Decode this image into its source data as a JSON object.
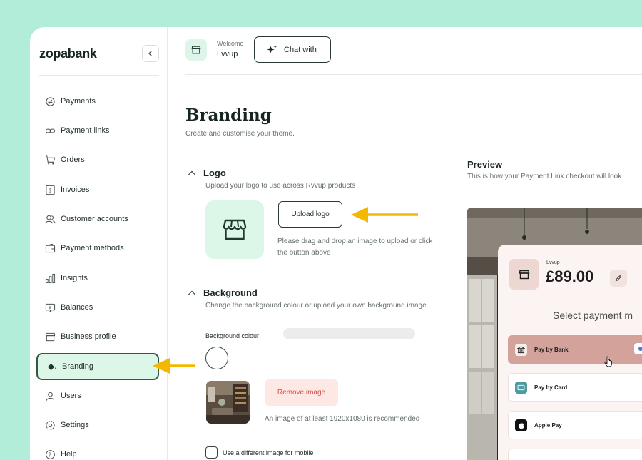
{
  "brand": {
    "name": "zopabank"
  },
  "sidebar": {
    "items": [
      {
        "label": "Payments",
        "icon": "payments-icon"
      },
      {
        "label": "Payment links",
        "icon": "link-icon"
      },
      {
        "label": "Orders",
        "icon": "cart-icon"
      },
      {
        "label": "Invoices",
        "icon": "invoice-icon"
      },
      {
        "label": "Customer accounts",
        "icon": "users-icon"
      },
      {
        "label": "Payment methods",
        "icon": "wallet-icon"
      },
      {
        "label": "Insights",
        "icon": "bar-chart-icon"
      },
      {
        "label": "Balances",
        "icon": "balance-icon"
      },
      {
        "label": "Business profile",
        "icon": "store-icon"
      },
      {
        "label": "Branding",
        "icon": "paint-bucket-icon",
        "active": true
      },
      {
        "label": "Users",
        "icon": "user-icon"
      },
      {
        "label": "Settings",
        "icon": "gear-icon"
      },
      {
        "label": "Help",
        "icon": "help-icon"
      }
    ]
  },
  "header": {
    "welcome_label": "Welcome",
    "account_name": "Lvvup",
    "chat_label": "Chat with"
  },
  "page": {
    "title": "Branding",
    "subtitle": "Create and customise your theme."
  },
  "logo_section": {
    "title": "Logo",
    "description": "Upload your logo to use across Rvvup products",
    "upload_label": "Upload logo",
    "drag_hint": "Please drag and drop an image to upload or click the button above"
  },
  "background_section": {
    "title": "Background",
    "description": "Change the background colour or upload your own background image",
    "colour_label": "Background colour",
    "remove_label": "Remove image",
    "image_hint": "An image of at least 1920x1080 is recommended",
    "mobile_label": "Use a different image for mobile"
  },
  "preview": {
    "title": "Preview",
    "subtitle": "This is how your Payment Link checkout will look",
    "merchant_name": "Lvvup",
    "amount": "£89.00",
    "select_heading": "Select payment m",
    "methods": [
      {
        "label": "Pay by Bank",
        "selected": true
      },
      {
        "label": "Pay by Card",
        "selected": false
      },
      {
        "label": "Apple Pay",
        "selected": false
      }
    ]
  },
  "colors": {
    "background": "#b2edda",
    "accent_green": "#dcf6e7",
    "active_border": "#2f5a43",
    "arrow": "#f5b800",
    "remove_red": "#d84e3d",
    "selected_method": "#d3a29a"
  }
}
